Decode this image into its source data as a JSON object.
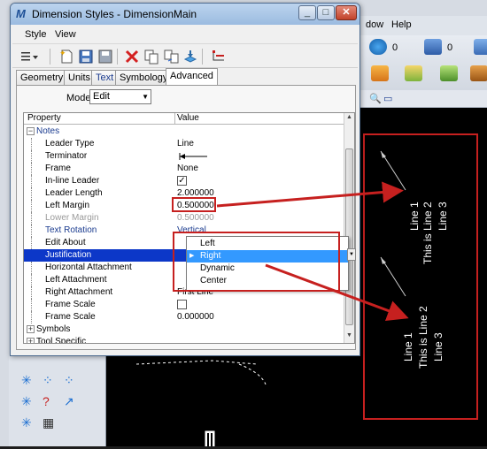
{
  "window": {
    "title": "Dimension Styles - DimensionMain",
    "minimize": "_",
    "maximize": "□",
    "close": "✕"
  },
  "background_app": {
    "menu_items": [
      "dow",
      "Help"
    ],
    "level_values": [
      "0",
      "0"
    ]
  },
  "menu": {
    "style": "Style",
    "view": "View"
  },
  "tabs": [
    "Geometry",
    "Units",
    "Text",
    "Symbology",
    "Advanced"
  ],
  "active_tab": "Advanced",
  "mode": {
    "label": "Mode:",
    "value": "Edit"
  },
  "grid": {
    "col_property": "Property",
    "col_value": "Value",
    "notes_group": "Notes",
    "rows": [
      {
        "key": "Leader Type",
        "value": "Line"
      },
      {
        "key": "Terminator",
        "value": ""
      },
      {
        "key": "Frame",
        "value": "None"
      },
      {
        "key": "In-line Leader",
        "value": "checked"
      },
      {
        "key": "Leader Length",
        "value": "2.000000"
      },
      {
        "key": "Left Margin",
        "value": "0.500000"
      },
      {
        "key": "Lower Margin",
        "value": "0.500000"
      },
      {
        "key": "Text Rotation",
        "value": "Vertical"
      },
      {
        "key": "Edit About",
        "value": ""
      },
      {
        "key": "Justification",
        "value": "Right"
      },
      {
        "key": "Horizontal Attachment",
        "value": ""
      },
      {
        "key": "Left Attachment",
        "value": ""
      },
      {
        "key": "Right Attachment",
        "value": "First Line"
      },
      {
        "key": "Frame Scale",
        "value": "unchecked"
      },
      {
        "key": "Frame Scale",
        "value": "0.000000"
      }
    ],
    "symbols_group": "Symbols",
    "tool_specific_group": "Tool Specific"
  },
  "justification_dropdown": {
    "options": [
      "Left",
      "Right",
      "Dynamic",
      "Center"
    ],
    "selected": "Right"
  },
  "sample": {
    "top": [
      "Line 1",
      "This is Line 2",
      "Line 3"
    ],
    "bottom": [
      "Line 1",
      "This is Line 2",
      "Line 3"
    ]
  },
  "colors": {
    "callout": "#c6201f",
    "selection": "#0c37c8",
    "dropdown_selection": "#3399ff"
  }
}
